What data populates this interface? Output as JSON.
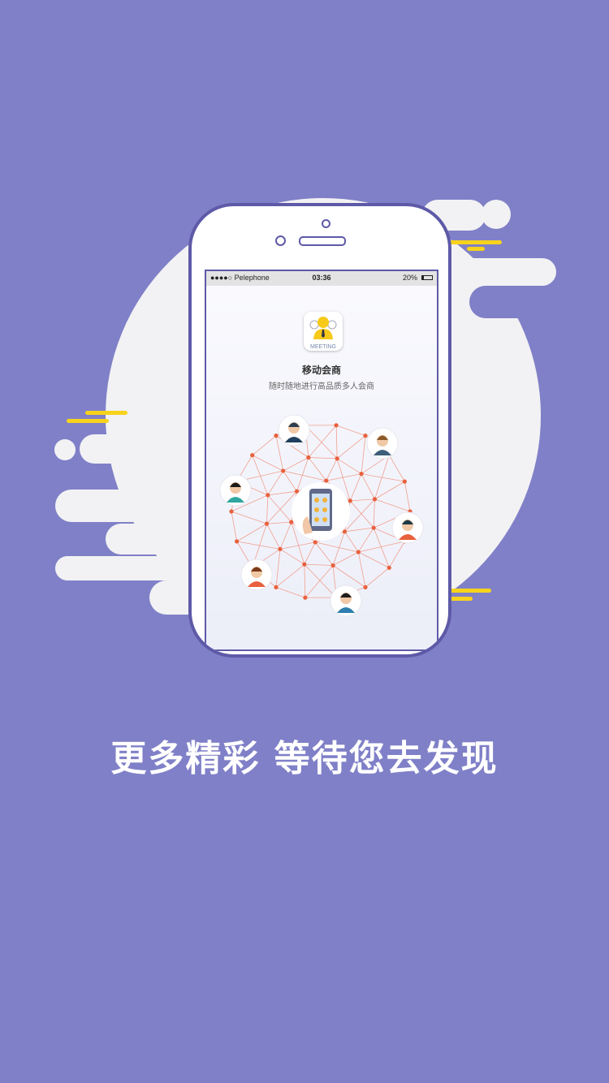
{
  "status_bar": {
    "carrier": "●●●●○ Pelephone",
    "time": "03:36",
    "battery_text": "20%",
    "battery_level": 0.2
  },
  "app": {
    "icon_label": "MEETING",
    "name": "移动会商",
    "tagline": "随时随地进行高品质多人会商"
  },
  "headline": "更多精彩 等待您去发现",
  "colors": {
    "background": "#8080c8",
    "phone_frame": "#5e5aa8",
    "accent_yellow": "#f7d31c",
    "network_line": "#f0a090",
    "network_node": "#e8603c"
  },
  "icons": [
    "user-avatar-icon",
    "phone-group-icon",
    "signal-icon",
    "wifi-icon",
    "battery-icon"
  ]
}
